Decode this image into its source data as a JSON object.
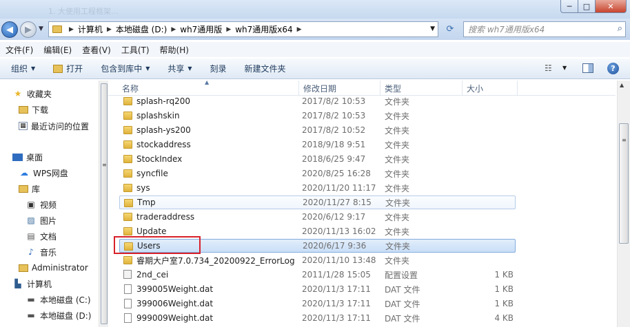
{
  "window": {
    "ghost_title": "1. 大使用工程框架...",
    "buttons": {
      "minimize": "─",
      "maximize": "□",
      "close": "✕"
    }
  },
  "address": {
    "crumbs": [
      "计算机",
      "本地磁盘 (D:)",
      "wh7通用版",
      "wh7通用版x64"
    ],
    "search_placeholder": "搜索 wh7通用版x64"
  },
  "menu": [
    "文件(F)",
    "编辑(E)",
    "查看(V)",
    "工具(T)",
    "帮助(H)"
  ],
  "toolbar": {
    "organize": "组织",
    "open": "打开",
    "include_in_library": "包含到库中",
    "share": "共享",
    "burn": "刻录",
    "new_folder": "新建文件夹"
  },
  "nav": {
    "items": [
      {
        "label": "收藏夹",
        "icon": "star-icon"
      },
      {
        "label": "下载",
        "icon": "download-folder-icon"
      },
      {
        "label": "最近访问的位置",
        "icon": "recent-places-icon"
      },
      {
        "label": "桌面",
        "icon": "desktop-icon"
      },
      {
        "label": "WPS网盘",
        "icon": "cloud-icon"
      },
      {
        "label": "库",
        "icon": "library-icon"
      },
      {
        "label": "视频",
        "icon": "video-icon"
      },
      {
        "label": "图片",
        "icon": "picture-icon"
      },
      {
        "label": "文档",
        "icon": "document-icon"
      },
      {
        "label": "音乐",
        "icon": "music-icon"
      },
      {
        "label": "Administrator",
        "icon": "user-icon"
      },
      {
        "label": "计算机",
        "icon": "computer-icon"
      },
      {
        "label": "本地磁盘 (C:)",
        "icon": "drive-icon"
      },
      {
        "label": "本地磁盘 (D:)",
        "icon": "drive-icon"
      }
    ]
  },
  "columns": {
    "name": "名称",
    "date": "修改日期",
    "type": "类型",
    "size": "大小"
  },
  "files": [
    {
      "name": "splash-rq200",
      "date": "2017/8/2 10:53",
      "type": "文件夹",
      "size": "",
      "kind": "folder"
    },
    {
      "name": "splashskin",
      "date": "2017/8/2 10:53",
      "type": "文件夹",
      "size": "",
      "kind": "folder"
    },
    {
      "name": "splash-ys200",
      "date": "2017/8/2 10:52",
      "type": "文件夹",
      "size": "",
      "kind": "folder"
    },
    {
      "name": "stockaddress",
      "date": "2018/9/18 9:51",
      "type": "文件夹",
      "size": "",
      "kind": "folder"
    },
    {
      "name": "StockIndex",
      "date": "2018/6/25 9:47",
      "type": "文件夹",
      "size": "",
      "kind": "folder"
    },
    {
      "name": "syncfile",
      "date": "2020/8/25 16:28",
      "type": "文件夹",
      "size": "",
      "kind": "folder"
    },
    {
      "name": "sys",
      "date": "2020/11/20 11:17",
      "type": "文件夹",
      "size": "",
      "kind": "folder"
    },
    {
      "name": "Tmp",
      "date": "2020/11/27 8:15",
      "type": "文件夹",
      "size": "",
      "kind": "folder"
    },
    {
      "name": "traderaddress",
      "date": "2020/6/12 9:17",
      "type": "文件夹",
      "size": "",
      "kind": "folder"
    },
    {
      "name": "Update",
      "date": "2020/11/13 16:02",
      "type": "文件夹",
      "size": "",
      "kind": "folder"
    },
    {
      "name": "Users",
      "date": "2020/6/17 9:36",
      "type": "文件夹",
      "size": "",
      "kind": "folder"
    },
    {
      "name": "睿期大户室7.0.734_20200922_ErrorLog",
      "date": "2020/11/10 13:48",
      "type": "文件夹",
      "size": "",
      "kind": "folder"
    },
    {
      "name": "2nd_cei",
      "date": "2011/1/28 15:05",
      "type": "配置设置",
      "size": "1 KB",
      "kind": "config"
    },
    {
      "name": "399005Weight.dat",
      "date": "2020/11/3 17:11",
      "type": "DAT 文件",
      "size": "1 KB",
      "kind": "file"
    },
    {
      "name": "399006Weight.dat",
      "date": "2020/11/3 17:11",
      "type": "DAT 文件",
      "size": "1 KB",
      "kind": "file"
    },
    {
      "name": "999009Weight.dat",
      "date": "2020/11/3 17:11",
      "type": "DAT 文件",
      "size": "4 KB",
      "kind": "file"
    }
  ],
  "selected_file": "Users",
  "hovered_file": "Tmp"
}
